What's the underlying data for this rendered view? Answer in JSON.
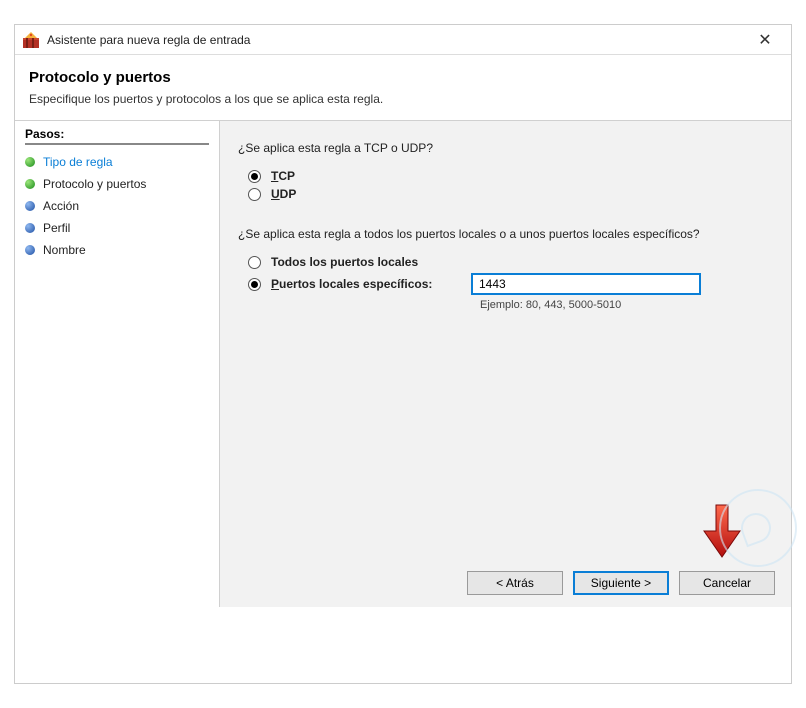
{
  "window": {
    "title": "Asistente para nueva regla de entrada"
  },
  "header": {
    "title": "Protocolo y puertos",
    "subtitle": "Especifique los puertos y protocolos a los que se aplica esta regla."
  },
  "sidebar": {
    "title": "Pasos:",
    "items": [
      {
        "label": "Tipo de regla"
      },
      {
        "label": "Protocolo y puertos"
      },
      {
        "label": "Acción"
      },
      {
        "label": "Perfil"
      },
      {
        "label": "Nombre"
      }
    ]
  },
  "content": {
    "q_protocol": "¿Se aplica esta regla a TCP o UDP?",
    "tcp_label": "TCP",
    "udp_label": "UDP",
    "q_ports": "¿Se aplica esta regla a todos los puertos locales o a unos puertos locales específicos?",
    "all_ports_label": "Todos los puertos locales",
    "specific_ports_label": "Puertos locales específicos:",
    "port_value": "1443",
    "port_example": "Ejemplo: 80, 443, 5000-5010"
  },
  "footer": {
    "back": "< Atrás",
    "next": "Siguiente >",
    "cancel": "Cancelar"
  }
}
